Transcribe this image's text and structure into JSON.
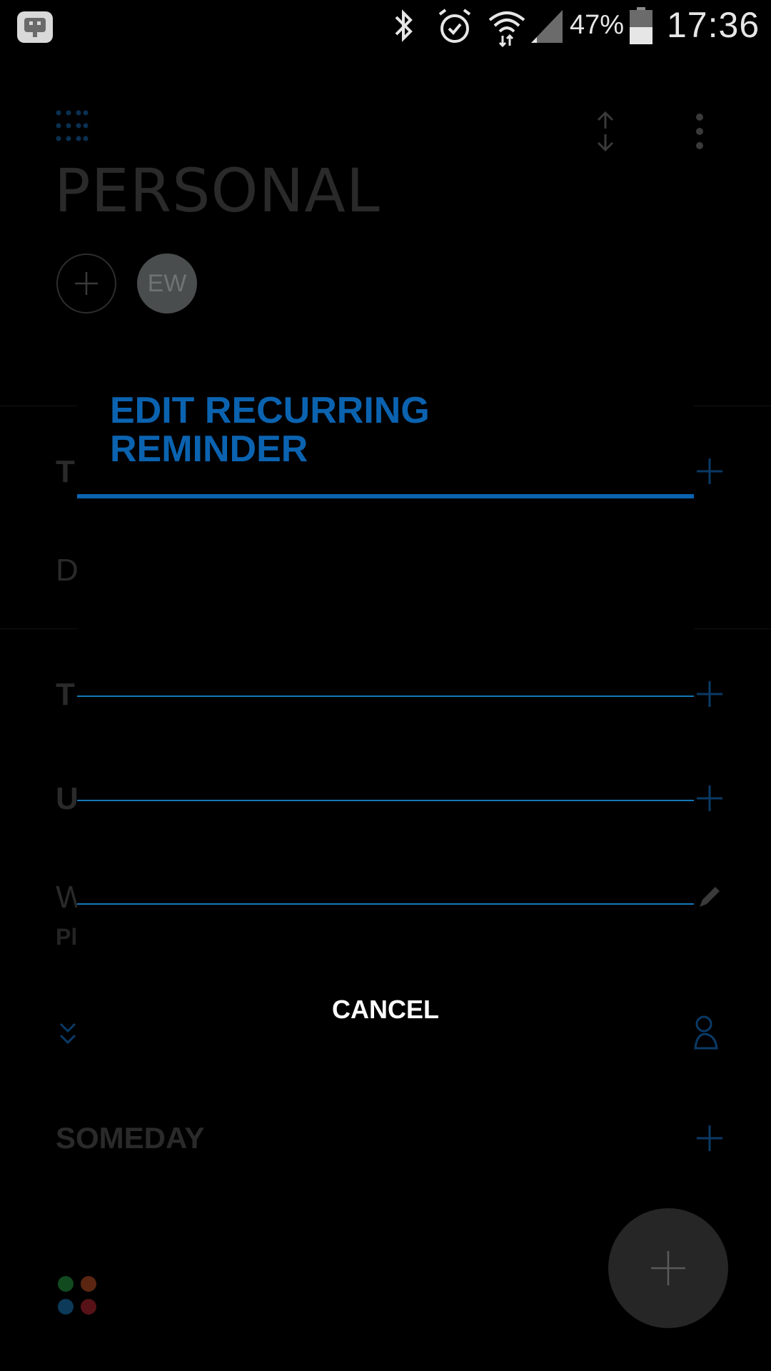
{
  "status_bar": {
    "battery_text": "47%",
    "time": "17:36",
    "icons": [
      "app-notification-icon",
      "bluetooth-icon",
      "alarm-icon",
      "wifi-icon",
      "signal-icon",
      "battery-icon"
    ]
  },
  "toolbar": {
    "icons": [
      "grid-menu-icon",
      "sort-icon",
      "more-options-icon"
    ]
  },
  "list": {
    "title": "PERSONAL",
    "avatar_initials": "EW"
  },
  "sections": {
    "row_1_head": "T",
    "row_2_text": "D",
    "row_3_head": "T",
    "row_4_head": "U",
    "row_5_text": "W",
    "row_5_sub": "Pl",
    "someday": "SOMEDAY"
  },
  "dialog": {
    "title_line1": "EDIT RECURRING",
    "title_line2": "REMINDER",
    "cancel_label": "CANCEL"
  },
  "colors": {
    "accent": "#0b63b0",
    "field_line": "#1478b8",
    "background": "#000000",
    "dim_text": "#2a2a2a"
  }
}
